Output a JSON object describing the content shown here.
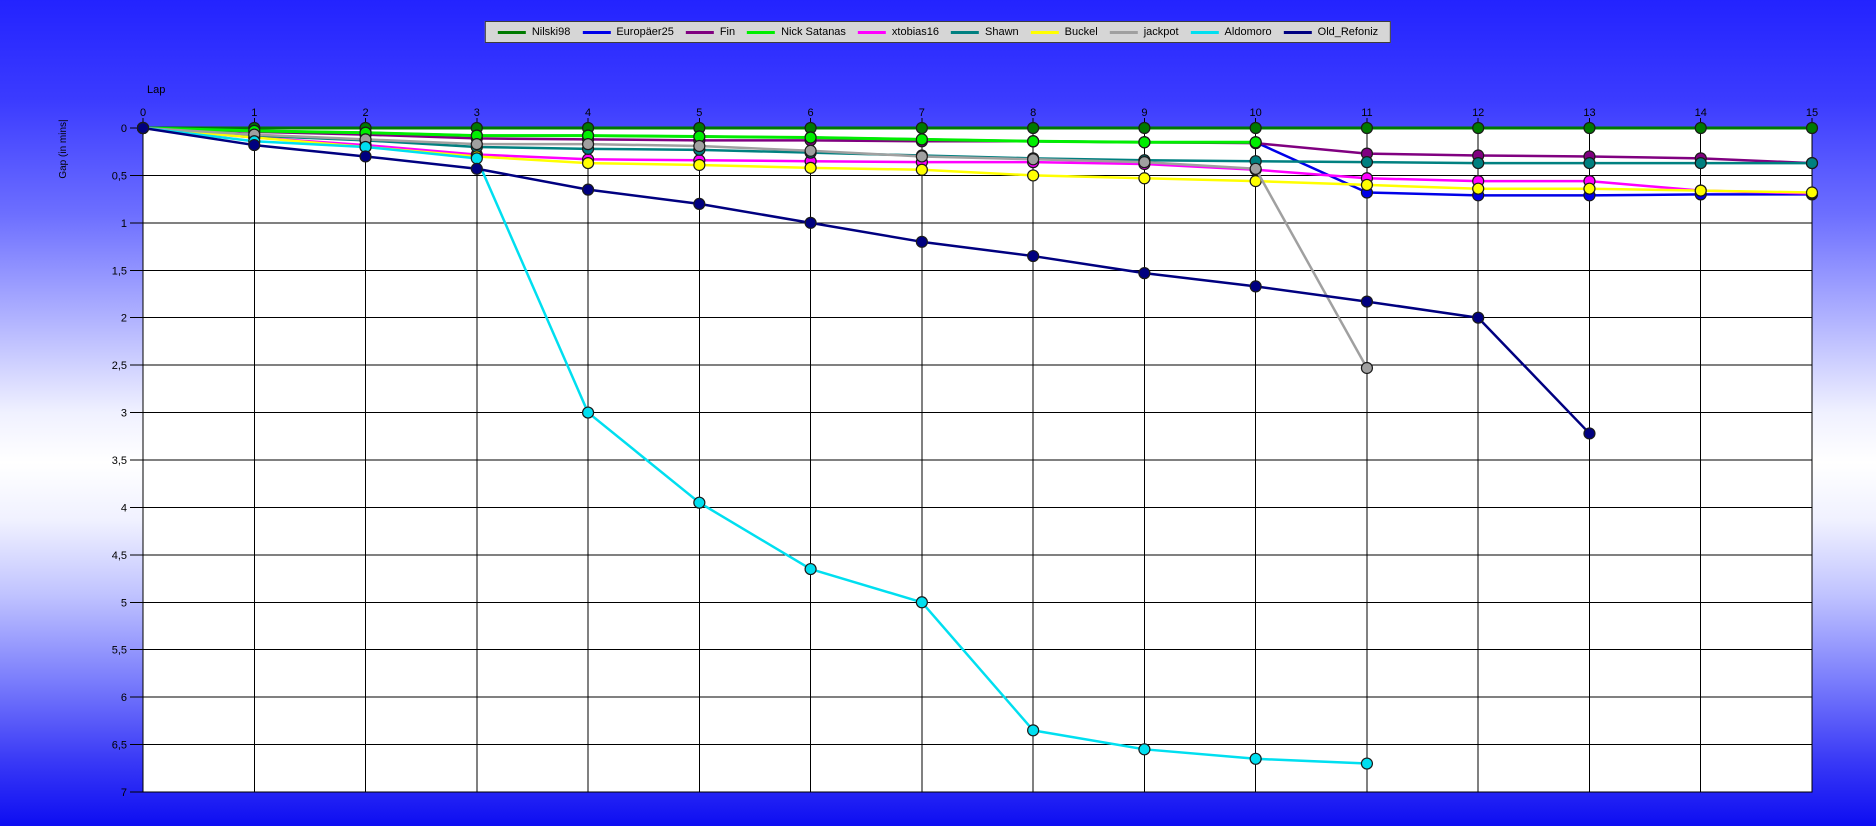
{
  "page": {
    "background_top_color": "#2323ff",
    "background_middle_color": "#ffffff",
    "background_bottom_color": "#0d0df2",
    "plot_background_color": "#ffffff",
    "gridline_color": "#000000"
  },
  "legend": {
    "position": "top-center",
    "background_color": "#d6d6d6",
    "border_color": "#3c3c3c"
  },
  "chart_data": {
    "type": "line",
    "title": "",
    "xlabel": "Lap",
    "ylabel": "Gap (in mins|",
    "xlim": [
      0,
      15
    ],
    "ylim": [
      0,
      7
    ],
    "y_axis_inverted_downward": true,
    "grid": true,
    "legend_position": "top-center",
    "x_ticks": [
      "0",
      "1",
      "2",
      "3",
      "4",
      "5",
      "6",
      "7",
      "8",
      "9",
      "10",
      "11",
      "12",
      "13",
      "14",
      "15"
    ],
    "y_ticks": [
      "0",
      "0,5",
      "1",
      "1,5",
      "2",
      "2,5",
      "3",
      "3,5",
      "4",
      "4,5",
      "5",
      "5,5",
      "6",
      "6,5",
      "7"
    ],
    "y_tick_values": [
      0,
      0.5,
      1,
      1.5,
      2,
      2.5,
      3,
      3.5,
      4,
      4.5,
      5,
      5.5,
      6,
      6.5,
      7
    ],
    "series": [
      {
        "name": "Nilski98",
        "color": "#007a00",
        "line_width": 3,
        "x": [
          0,
          1,
          2,
          3,
          4,
          5,
          6,
          7,
          8,
          9,
          10,
          11,
          12,
          13,
          14,
          15
        ],
        "values": [
          0,
          0,
          0,
          0,
          0,
          0,
          0,
          0,
          0,
          0,
          0,
          0,
          0,
          0,
          0,
          0
        ]
      },
      {
        "name": "Europäer25",
        "color": "#0000e8",
        "line_width": 2.5,
        "x": [
          0,
          1,
          2,
          3,
          4,
          5,
          6,
          7,
          8,
          9,
          10,
          11,
          12,
          13,
          14,
          15
        ],
        "values": [
          0,
          0.03,
          0.05,
          0.08,
          0.08,
          0.09,
          0.1,
          0.12,
          0.14,
          0.15,
          0.15,
          0.68,
          0.71,
          0.71,
          0.7,
          0.7
        ]
      },
      {
        "name": "Fin",
        "color": "#800080",
        "line_width": 2.5,
        "x": [
          0,
          1,
          2,
          3,
          4,
          5,
          6,
          7,
          8,
          9,
          10,
          11,
          12,
          13,
          14,
          15
        ],
        "values": [
          0,
          0.04,
          0.07,
          0.11,
          0.12,
          0.13,
          0.13,
          0.14,
          0.14,
          0.15,
          0.16,
          0.27,
          0.29,
          0.3,
          0.32,
          0.37
        ]
      },
      {
        "name": "Nick Satanas",
        "color": "#00ee00",
        "line_width": 3,
        "x": [
          0,
          1,
          2,
          3,
          4,
          5,
          6,
          7,
          8,
          9,
          10
        ],
        "values": [
          0,
          0.03,
          0.05,
          0.08,
          0.08,
          0.09,
          0.1,
          0.12,
          0.14,
          0.15,
          0.15
        ]
      },
      {
        "name": "xtobias16",
        "color": "#ff00ff",
        "line_width": 2.5,
        "x": [
          0,
          1,
          2,
          3,
          4,
          5,
          6,
          7,
          8,
          9,
          10,
          11,
          12,
          13,
          14,
          15
        ],
        "values": [
          0,
          0.1,
          0.18,
          0.28,
          0.33,
          0.34,
          0.35,
          0.36,
          0.36,
          0.38,
          0.44,
          0.53,
          0.56,
          0.56,
          0.66,
          0.69
        ]
      },
      {
        "name": "Shawn",
        "color": "#008080",
        "line_width": 2.5,
        "x": [
          0,
          1,
          2,
          3,
          4,
          5,
          6,
          7,
          8,
          9,
          10,
          11,
          12,
          13,
          14,
          15
        ],
        "values": [
          0,
          0.08,
          0.13,
          0.2,
          0.22,
          0.23,
          0.26,
          0.29,
          0.32,
          0.34,
          0.35,
          0.36,
          0.37,
          0.37,
          0.37,
          0.37
        ]
      },
      {
        "name": "Buckel",
        "color": "#ffff00",
        "line_width": 2.5,
        "x": [
          0,
          1,
          2,
          3,
          4,
          5,
          6,
          7,
          8,
          9,
          10,
          11,
          12,
          13,
          14,
          15
        ],
        "values": [
          0,
          0.1,
          0.2,
          0.3,
          0.37,
          0.39,
          0.42,
          0.44,
          0.5,
          0.53,
          0.56,
          0.6,
          0.64,
          0.64,
          0.66,
          0.68
        ]
      },
      {
        "name": "jackpot",
        "color": "#a0a0a0",
        "line_width": 2.5,
        "x": [
          0,
          1,
          2,
          3,
          4,
          5,
          6,
          7,
          8,
          9,
          10,
          11
        ],
        "values": [
          0,
          0.07,
          0.12,
          0.17,
          0.17,
          0.19,
          0.24,
          0.3,
          0.33,
          0.36,
          0.43,
          2.53
        ]
      },
      {
        "name": "Aldomoro",
        "color": "#00dff0",
        "line_width": 2.5,
        "x": [
          0,
          1,
          2,
          3,
          4,
          5,
          6,
          7,
          8,
          9,
          10,
          11
        ],
        "values": [
          0,
          0.14,
          0.2,
          0.32,
          3.0,
          3.95,
          4.65,
          5.0,
          6.35,
          6.55,
          6.65,
          6.7
        ]
      },
      {
        "name": "Old_Refoniz",
        "color": "#000080",
        "line_width": 2.5,
        "x": [
          0,
          1,
          2,
          3,
          4,
          5,
          6,
          7,
          8,
          9,
          10,
          11,
          12,
          13
        ],
        "values": [
          0,
          0.18,
          0.3,
          0.43,
          0.65,
          0.8,
          1.0,
          1.2,
          1.35,
          1.53,
          1.67,
          1.83,
          2.0,
          3.22
        ]
      }
    ]
  }
}
